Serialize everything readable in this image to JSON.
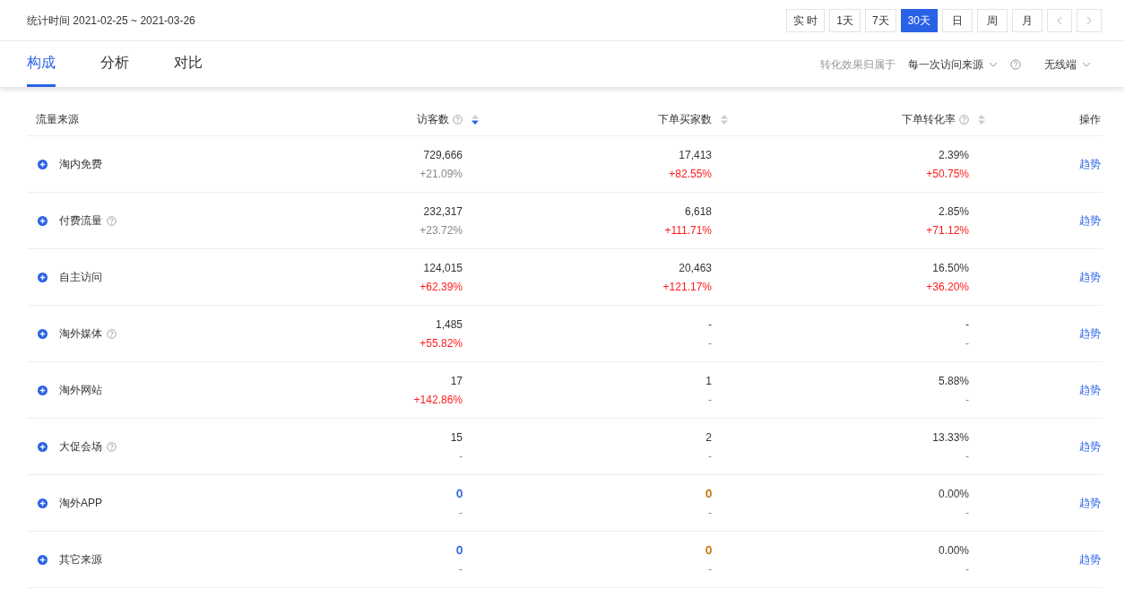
{
  "period": {
    "label": "统计时间 2021-02-25 ~ 2021-03-26"
  },
  "range_buttons": [
    {
      "label": "实 时",
      "selected": false
    },
    {
      "label": "1天",
      "selected": false
    },
    {
      "label": "7天",
      "selected": false
    },
    {
      "label": "30天",
      "selected": true
    },
    {
      "label": "日",
      "selected": false
    },
    {
      "label": "周",
      "selected": false
    },
    {
      "label": "月",
      "selected": false
    }
  ],
  "tabs": [
    {
      "label": "构成",
      "selected": true
    },
    {
      "label": "分析",
      "selected": false
    },
    {
      "label": "对比",
      "selected": false
    }
  ],
  "attribution": {
    "label": "转化效果归属于",
    "value": "每一次访问来源",
    "device": "无线端"
  },
  "table": {
    "columns": [
      {
        "label": "流量来源",
        "help": false,
        "sortable": false
      },
      {
        "label": "访客数",
        "help": true,
        "sortable": true,
        "sorted": true
      },
      {
        "label": "下单买家数",
        "help": false,
        "sortable": true,
        "sorted": false
      },
      {
        "label": "下单转化率",
        "help": true,
        "sortable": true,
        "sorted": false
      },
      {
        "label": "操作",
        "help": false,
        "sortable": false
      }
    ],
    "rows": [
      {
        "cells": [
          {
            "kind": "source",
            "value": "淘内免费",
            "help": false
          },
          {
            "kind": "metric",
            "value": "729,666",
            "change": "+21.09%",
            "highlight": false
          },
          {
            "kind": "metric",
            "value": "17,413",
            "change": "+82.55%",
            "highlight": true
          },
          {
            "kind": "metric",
            "value": "2.39%",
            "change": "+50.75%",
            "highlight": true
          },
          {
            "kind": "action",
            "value": "趋势"
          }
        ]
      },
      {
        "cells": [
          {
            "kind": "source",
            "value": "付费流量",
            "help": true
          },
          {
            "kind": "metric",
            "value": "232,317",
            "change": "+23.72%",
            "highlight": false
          },
          {
            "kind": "metric",
            "value": "6,618",
            "change": "+111.71%",
            "highlight": true
          },
          {
            "kind": "metric",
            "value": "2.85%",
            "change": "+71.12%",
            "highlight": true
          },
          {
            "kind": "action",
            "value": "趋势"
          }
        ]
      },
      {
        "cells": [
          {
            "kind": "source",
            "value": "自主访问",
            "help": false
          },
          {
            "kind": "metric",
            "value": "124,015",
            "change": "+62.39%",
            "highlight": true
          },
          {
            "kind": "metric",
            "value": "20,463",
            "change": "+121.17%",
            "highlight": true
          },
          {
            "kind": "metric",
            "value": "16.50%",
            "change": "+36.20%",
            "highlight": true
          },
          {
            "kind": "action",
            "value": "趋势"
          }
        ]
      },
      {
        "cells": [
          {
            "kind": "source",
            "value": "淘外媒体",
            "help": true
          },
          {
            "kind": "metric",
            "value": "1,485",
            "change": "+55.82%",
            "highlight": true
          },
          {
            "kind": "metric",
            "value": "-",
            "change": "-",
            "highlight": false
          },
          {
            "kind": "metric",
            "value": "-",
            "change": "-",
            "highlight": false
          },
          {
            "kind": "action",
            "value": "趋势"
          }
        ]
      },
      {
        "cells": [
          {
            "kind": "source",
            "value": "淘外网站",
            "help": false
          },
          {
            "kind": "metric",
            "value": "17",
            "change": "+142.86%",
            "highlight": true
          },
          {
            "kind": "metric",
            "value": "1",
            "change": "-",
            "highlight": false
          },
          {
            "kind": "metric",
            "value": "5.88%",
            "change": "-",
            "highlight": false
          },
          {
            "kind": "action",
            "value": "趋势"
          }
        ]
      },
      {
        "cells": [
          {
            "kind": "source",
            "value": "大促会场",
            "help": true
          },
          {
            "kind": "metric",
            "value": "15",
            "change": "-",
            "highlight": false
          },
          {
            "kind": "metric",
            "value": "2",
            "change": "-",
            "highlight": false
          },
          {
            "kind": "metric",
            "value": "13.33%",
            "change": "-",
            "highlight": false
          },
          {
            "kind": "action",
            "value": "趋势"
          }
        ]
      },
      {
        "cells": [
          {
            "kind": "source",
            "value": "淘外APP",
            "help": false
          },
          {
            "kind": "metric",
            "value": "0",
            "change": "-",
            "highlight": false,
            "color": "#2962e6"
          },
          {
            "kind": "metric",
            "value": "0",
            "change": "-",
            "highlight": false,
            "color": "#c87000"
          },
          {
            "kind": "metric",
            "value": "0.00%",
            "change": "-",
            "highlight": false
          },
          {
            "kind": "action",
            "value": "趋势"
          }
        ]
      },
      {
        "cells": [
          {
            "kind": "source",
            "value": "其它来源",
            "help": false
          },
          {
            "kind": "metric",
            "value": "0",
            "change": "-",
            "highlight": false,
            "color": "#2962e6"
          },
          {
            "kind": "metric",
            "value": "0",
            "change": "-",
            "highlight": false,
            "color": "#c87000"
          },
          {
            "kind": "metric",
            "value": "0.00%",
            "change": "-",
            "highlight": false
          },
          {
            "kind": "action",
            "value": "趋势"
          }
        ]
      }
    ]
  }
}
